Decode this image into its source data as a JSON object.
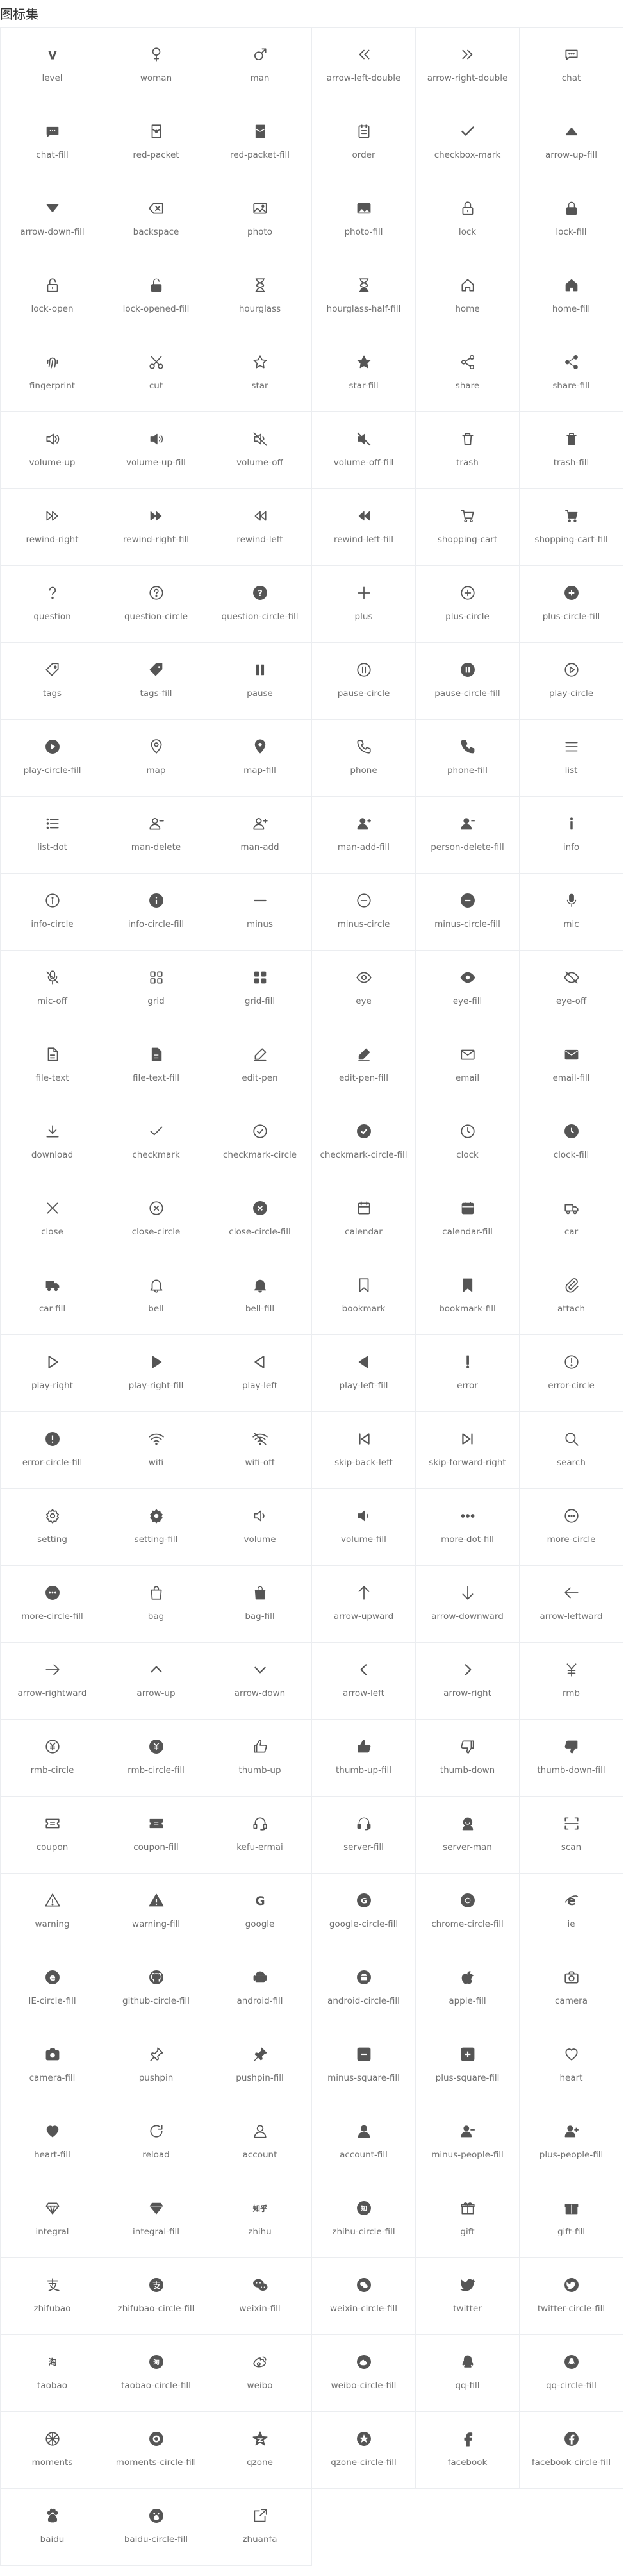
{
  "page": {
    "title": "图标集"
  },
  "colors": {
    "icon": "#555555",
    "label": "#707070",
    "border": "#ebedf0"
  },
  "icons": [
    "level",
    "woman",
    "man",
    "arrow-left-double",
    "arrow-right-double",
    "chat",
    "chat-fill",
    "red-packet",
    "red-packet-fill",
    "order",
    "checkbox-mark",
    "arrow-up-fill",
    "arrow-down-fill",
    "backspace",
    "photo",
    "photo-fill",
    "lock",
    "lock-fill",
    "lock-open",
    "lock-opened-fill",
    "hourglass",
    "hourglass-half-fill",
    "home",
    "home-fill",
    "fingerprint",
    "cut",
    "star",
    "star-fill",
    "share",
    "share-fill",
    "volume-up",
    "volume-up-fill",
    "volume-off",
    "volume-off-fill",
    "trash",
    "trash-fill",
    "rewind-right",
    "rewind-right-fill",
    "rewind-left",
    "rewind-left-fill",
    "shopping-cart",
    "shopping-cart-fill",
    "question",
    "question-circle",
    "question-circle-fill",
    "plus",
    "plus-circle",
    "plus-circle-fill",
    "tags",
    "tags-fill",
    "pause",
    "pause-circle",
    "pause-circle-fill",
    "play-circle",
    "play-circle-fill",
    "map",
    "map-fill",
    "phone",
    "phone-fill",
    "list",
    "list-dot",
    "man-delete",
    "man-add",
    "man-add-fill",
    "person-delete-fill",
    "info",
    "info-circle",
    "info-circle-fill",
    "minus",
    "minus-circle",
    "minus-circle-fill",
    "mic",
    "mic-off",
    "grid",
    "grid-fill",
    "eye",
    "eye-fill",
    "eye-off",
    "file-text",
    "file-text-fill",
    "edit-pen",
    "edit-pen-fill",
    "email",
    "email-fill",
    "download",
    "checkmark",
    "checkmark-circle",
    "checkmark-circle-fill",
    "clock",
    "clock-fill",
    "close",
    "close-circle",
    "close-circle-fill",
    "calendar",
    "calendar-fill",
    "car",
    "car-fill",
    "bell",
    "bell-fill",
    "bookmark",
    "bookmark-fill",
    "attach",
    "play-right",
    "play-right-fill",
    "play-left",
    "play-left-fill",
    "error",
    "error-circle",
    "error-circle-fill",
    "wifi",
    "wifi-off",
    "skip-back-left",
    "skip-forward-right",
    "search",
    "setting",
    "setting-fill",
    "volume",
    "volume-fill",
    "more-dot-fill",
    "more-circle",
    "more-circle-fill",
    "bag",
    "bag-fill",
    "arrow-upward",
    "arrow-downward",
    "arrow-leftward",
    "arrow-rightward",
    "arrow-up",
    "arrow-down",
    "arrow-left",
    "arrow-right",
    "rmb",
    "rmb-circle",
    "rmb-circle-fill",
    "thumb-up",
    "thumb-up-fill",
    "thumb-down",
    "thumb-down-fill",
    "coupon",
    "coupon-fill",
    "kefu-ermai",
    "server-fill",
    "server-man",
    "scan",
    "warning",
    "warning-fill",
    "google",
    "google-circle-fill",
    "chrome-circle-fill",
    "ie",
    "IE-circle-fill",
    "github-circle-fill",
    "android-fill",
    "android-circle-fill",
    "apple-fill",
    "camera",
    "camera-fill",
    "pushpin",
    "pushpin-fill",
    "minus-square-fill",
    "plus-square-fill",
    "heart",
    "heart-fill",
    "reload",
    "account",
    "account-fill",
    "minus-people-fill",
    "plus-people-fill",
    "integral",
    "integral-fill",
    "zhihu",
    "zhihu-circle-fill",
    "gift",
    "gift-fill",
    "zhifubao",
    "zhifubao-circle-fill",
    "weixin-fill",
    "weixin-circle-fill",
    "twitter",
    "twitter-circle-fill",
    "taobao",
    "taobao-circle-fill",
    "weibo",
    "weibo-circle-fill",
    "qq-fill",
    "qq-circle-fill",
    "moments",
    "moments-circle-fill",
    "qzone",
    "qzone-circle-fill",
    "facebook",
    "facebook-circle-fill",
    "baidu",
    "baidu-circle-fill",
    "zhuanfa"
  ]
}
